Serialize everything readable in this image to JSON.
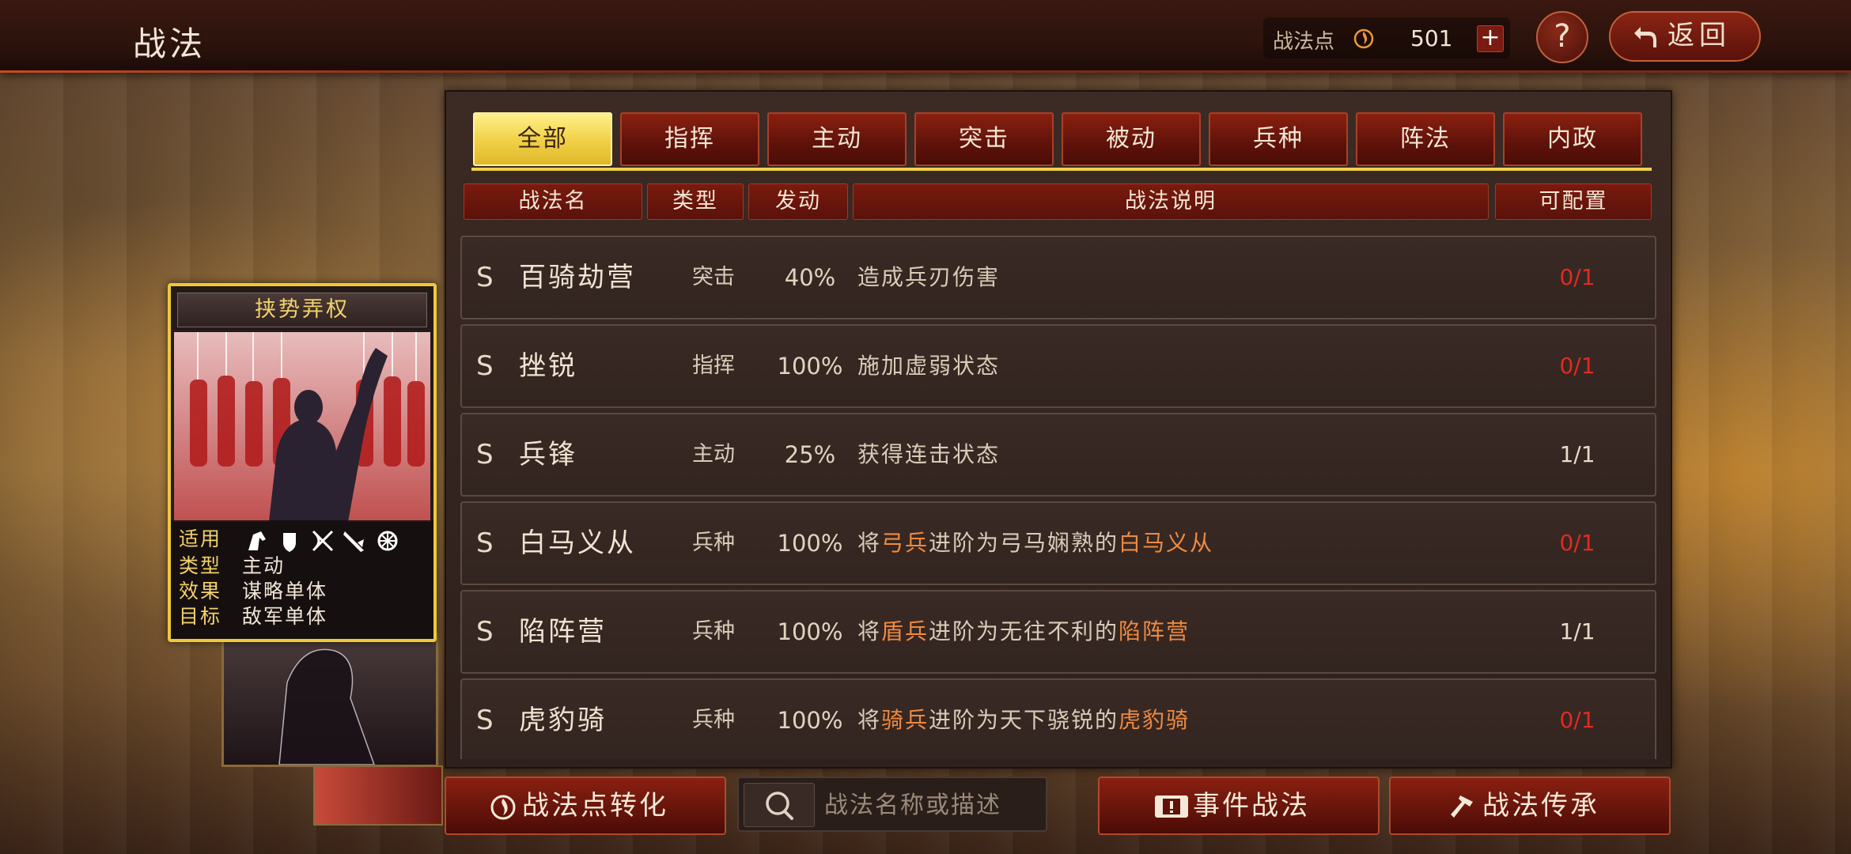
{
  "header": {
    "title": "战法",
    "points_label": "战法点",
    "points_value": "501",
    "plus_label": "+",
    "help_label": "?",
    "back_label": "返回"
  },
  "tabs": [
    {
      "label": "全部",
      "active": true
    },
    {
      "label": "指挥",
      "active": false
    },
    {
      "label": "主动",
      "active": false
    },
    {
      "label": "突击",
      "active": false
    },
    {
      "label": "被动",
      "active": false
    },
    {
      "label": "兵种",
      "active": false
    },
    {
      "label": "阵法",
      "active": false
    },
    {
      "label": "内政",
      "active": false
    }
  ],
  "columns": {
    "name": "战法名",
    "type": "类型",
    "rate": "发动",
    "desc": "战法说明",
    "config": "可配置"
  },
  "rows": [
    {
      "grade": "S",
      "name": "百骑劫营",
      "type": "突击",
      "rate": "40%",
      "desc_pre": "造成兵刃伤害",
      "desc_hl1": "",
      "desc_mid": "",
      "desc_hl2": "",
      "config": "0/1",
      "config_red": true
    },
    {
      "grade": "S",
      "name": "挫锐",
      "type": "指挥",
      "rate": "100%",
      "desc_pre": "施加虚弱状态",
      "desc_hl1": "",
      "desc_mid": "",
      "desc_hl2": "",
      "config": "0/1",
      "config_red": true
    },
    {
      "grade": "S",
      "name": "兵锋",
      "type": "主动",
      "rate": "25%",
      "desc_pre": "获得连击状态",
      "desc_hl1": "",
      "desc_mid": "",
      "desc_hl2": "",
      "config": "1/1",
      "config_red": false
    },
    {
      "grade": "S",
      "name": "白马义从",
      "type": "兵种",
      "rate": "100%",
      "desc_pre": "将",
      "desc_hl1": "弓兵",
      "desc_mid": "进阶为弓马娴熟的",
      "desc_hl2": "白马义从",
      "config": "0/1",
      "config_red": true
    },
    {
      "grade": "S",
      "name": "陷阵营",
      "type": "兵种",
      "rate": "100%",
      "desc_pre": "将",
      "desc_hl1": "盾兵",
      "desc_mid": "进阶为无往不利的",
      "desc_hl2": "陷阵营",
      "config": "1/1",
      "config_red": false
    },
    {
      "grade": "S",
      "name": "虎豹骑",
      "type": "兵种",
      "rate": "100%",
      "desc_pre": "将",
      "desc_hl1": "骑兵",
      "desc_mid": "进阶为天下骁锐的",
      "desc_hl2": "虎豹骑",
      "config": "0/1",
      "config_red": true
    }
  ],
  "card": {
    "title": "挟势弄权",
    "apply_key": "适用",
    "type_key": "类型",
    "type_val": "主动",
    "effect_key": "效果",
    "effect_val": "谋略单体",
    "target_key": "目标",
    "target_val": "敌军单体",
    "unit_icons": [
      "cavalry-icon",
      "shield-icon",
      "archer-icon",
      "spear-icon",
      "siege-icon"
    ]
  },
  "bottom": {
    "convert_label": "战法点转化",
    "search_placeholder": "战法名称或描述",
    "event_label": "事件战法",
    "inherit_label": "战法传承"
  },
  "colors": {
    "accent_gold": "#f0c838",
    "tab_red": "#8a2010",
    "config_red": "#e22a20",
    "highlight_orange": "#ee8a40"
  }
}
